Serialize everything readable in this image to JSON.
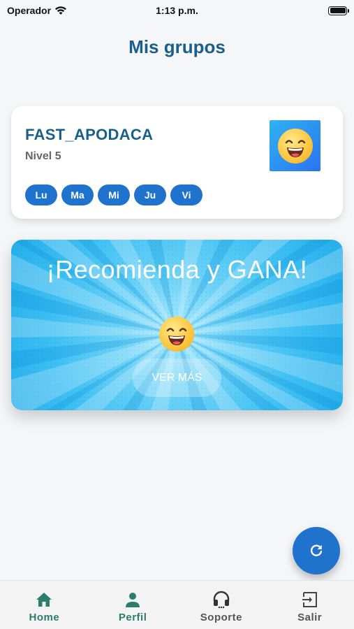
{
  "status_bar": {
    "carrier": "Operador",
    "time": "1:13 p.m."
  },
  "page": {
    "title": "Mis grupos"
  },
  "groups": [
    {
      "name": "FAST_APODACA",
      "level": "Nivel 5",
      "avatar_icon": "grinning-face-icon",
      "days": [
        "Lu",
        "Ma",
        "Mi",
        "Ju",
        "Vi"
      ]
    }
  ],
  "promo": {
    "title": "¡Recomienda y GANA!",
    "button_label": "VER MÁS",
    "icon": "grinning-face-icon"
  },
  "fab": {
    "icon": "refresh-icon"
  },
  "bottom_nav": {
    "items": [
      {
        "label": "Home",
        "icon": "home-icon",
        "active": true
      },
      {
        "label": "Perfil",
        "icon": "person-icon",
        "active": true
      },
      {
        "label": "Soporte",
        "icon": "headset-icon",
        "active": false
      },
      {
        "label": "Salir",
        "icon": "exit-icon",
        "active": false
      }
    ]
  },
  "colors": {
    "title_blue": "#1a5e8a",
    "pill_blue": "#1f73cc",
    "nav_active": "#2b7d6d",
    "promo_cyan": "#3fc0f3"
  }
}
